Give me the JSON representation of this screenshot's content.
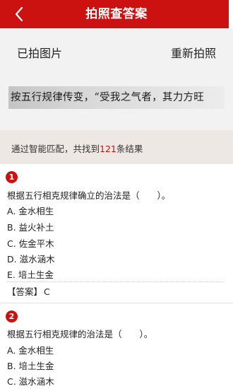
{
  "header": {
    "title": "拍照查答案",
    "back_icon": "chevron-left-icon",
    "color": "#cc1111"
  },
  "photo": {
    "taken_label": "已拍图片",
    "retake_label": "重新拍照",
    "snippet_text": "按五行规律传变，“受我之气者，其力方旺"
  },
  "match": {
    "prefix": "通过智能匹配，共找到",
    "count": "121",
    "suffix": "条结果",
    "count_color": "#cc1111"
  },
  "questions": [
    {
      "number": "1",
      "text": "根据五行相克规律确立的治法是（　　）。",
      "options": [
        "A. 金水相生",
        "B. 益火补土",
        "C. 佐金平木",
        "D. 滋水涵木",
        "E. 培土生金"
      ],
      "answer_label": "【答案】",
      "answer": "C"
    },
    {
      "number": "2",
      "text": "根据五行相克规律的治法是（　　）。",
      "options": [
        "A. 金水相生",
        "B. 培土生金",
        "C. 滋水涵木"
      ]
    }
  ]
}
